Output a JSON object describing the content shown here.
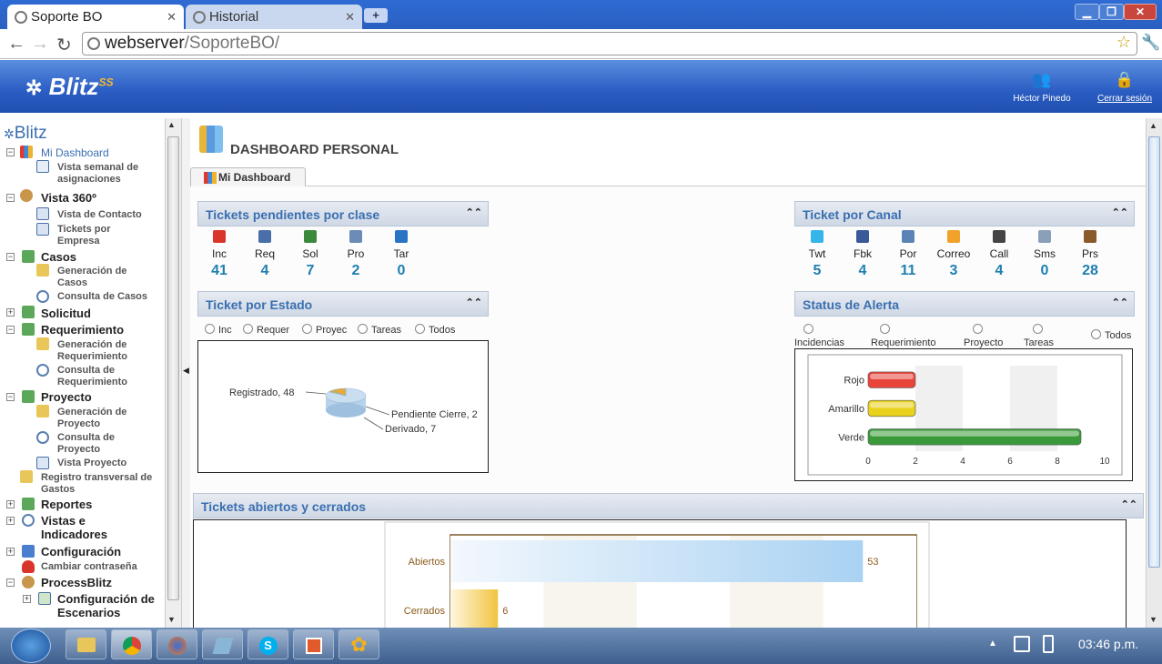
{
  "browser": {
    "tabs": [
      {
        "label": "Soporte BO",
        "active": true
      },
      {
        "label": "Historial",
        "active": false
      }
    ],
    "url_host": "webserver",
    "url_path": "/SoporteBO/"
  },
  "header": {
    "brand": "Blitz",
    "brand_sup": "SS",
    "user_name": "Héctor Pinedo",
    "logout": "Cerrar sesión"
  },
  "sidebar": {
    "root": "Blitz",
    "items": [
      {
        "label": "Mi Dashboard"
      },
      {
        "label": "Vista semanal de asignaciones"
      },
      {
        "label": "Vista 360º"
      },
      {
        "label": "Vista de Contacto"
      },
      {
        "label": "Tickets por Empresa"
      },
      {
        "label": "Casos"
      },
      {
        "label": "Generación de Casos"
      },
      {
        "label": "Consulta de Casos"
      },
      {
        "label": "Solicitud"
      },
      {
        "label": "Requerimiento"
      },
      {
        "label": "Generación de Requerimiento"
      },
      {
        "label": "Consulta de Requerimiento"
      },
      {
        "label": "Proyecto"
      },
      {
        "label": "Generación de Proyecto"
      },
      {
        "label": "Consulta de Proyecto"
      },
      {
        "label": "Vista Proyecto"
      },
      {
        "label": "Registro transversal de Gastos"
      },
      {
        "label": "Reportes"
      },
      {
        "label": "Vistas e Indicadores"
      },
      {
        "label": "Configuración"
      },
      {
        "label": "Cambiar contraseña"
      },
      {
        "label": "ProcessBlitz"
      },
      {
        "label": "Configuración de Escenarios"
      }
    ]
  },
  "main": {
    "page_title": "DASHBOARD PERSONAL",
    "tab": "Mi Dashboard",
    "pendientes": {
      "title": "Tickets pendientes por clase",
      "items": [
        {
          "label": "Inc",
          "value": "41",
          "color": "#d9352b"
        },
        {
          "label": "Req",
          "value": "4",
          "color": "#4a6fa8"
        },
        {
          "label": "Sol",
          "value": "7",
          "color": "#3b8a3b"
        },
        {
          "label": "Pro",
          "value": "2",
          "color": "#6a8cb5"
        },
        {
          "label": "Tar",
          "value": "0",
          "color": "#2a74c4"
        }
      ]
    },
    "canal": {
      "title": "Ticket por Canal",
      "items": [
        {
          "label": "Twt",
          "value": "5",
          "color": "#35b5e8"
        },
        {
          "label": "Fbk",
          "value": "4",
          "color": "#3b5998"
        },
        {
          "label": "Por",
          "value": "11",
          "color": "#5b84b6"
        },
        {
          "label": "Correo",
          "value": "3",
          "color": "#f0a22b"
        },
        {
          "label": "Call",
          "value": "4",
          "color": "#444"
        },
        {
          "label": "Sms",
          "value": "0",
          "color": "#8aa0b8"
        },
        {
          "label": "Prs",
          "value": "28",
          "color": "#8a5a2b"
        }
      ]
    },
    "estado": {
      "title": "Ticket por Estado",
      "filters": [
        "Inc",
        "Requer",
        "Proyec",
        "Tareas",
        "Todos"
      ],
      "pie_labels": [
        "Registrado, 48",
        "Pendiente Cierre, 2",
        "Derivado, 7"
      ]
    },
    "alerta": {
      "title": "Status de Alerta",
      "filters": [
        "Incidencias",
        "Requerimiento",
        "Proyecto",
        "Tareas",
        "Todos"
      ]
    },
    "abiertos": {
      "title": "Tickets abiertos y cerrados"
    }
  },
  "taskbar": {
    "clock": "03:46 p.m."
  },
  "chart_data": [
    {
      "type": "pie",
      "categories": [
        "Registrado",
        "Pendiente Cierre",
        "Derivado"
      ],
      "values": [
        48,
        2,
        7
      ]
    },
    {
      "type": "bar",
      "orientation": "horizontal",
      "categories": [
        "Rojo",
        "Amarillo",
        "Verde"
      ],
      "values": [
        2,
        2,
        9
      ],
      "colors": [
        "#e8443a",
        "#e9d21c",
        "#3a9a3a"
      ],
      "xlim": [
        0,
        10
      ],
      "xticks": [
        "0",
        "2",
        "4",
        "6",
        "8",
        "10"
      ]
    },
    {
      "type": "bar",
      "orientation": "horizontal",
      "categories": [
        "Abiertos",
        "Cerrados"
      ],
      "values": [
        53,
        6
      ],
      "data_labels": [
        "53",
        "6"
      ],
      "xlim": [
        0,
        60
      ]
    }
  ]
}
